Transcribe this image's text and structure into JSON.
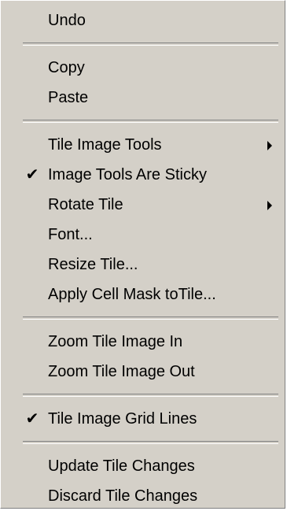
{
  "menu": {
    "groups": [
      {
        "items": [
          {
            "label": "Undo"
          }
        ]
      },
      {
        "items": [
          {
            "label": "Copy"
          },
          {
            "label": "Paste"
          }
        ]
      },
      {
        "items": [
          {
            "label": "Tile Image Tools",
            "submenu": true
          },
          {
            "label": "Image Tools Are Sticky",
            "checked": true
          },
          {
            "label": "Rotate Tile",
            "submenu": true
          },
          {
            "label": "Font..."
          },
          {
            "label": "Resize Tile..."
          },
          {
            "label": "Apply Cell Mask toTile..."
          }
        ]
      },
      {
        "items": [
          {
            "label": "Zoom Tile Image In"
          },
          {
            "label": "Zoom Tile Image Out"
          }
        ]
      },
      {
        "items": [
          {
            "label": "Tile Image Grid Lines",
            "checked": true
          }
        ]
      },
      {
        "items": [
          {
            "label": "Update Tile Changes"
          },
          {
            "label": "Discard Tile Changes"
          }
        ]
      }
    ],
    "check_glyph": "✔",
    "colors": {
      "background": "#d4d0c8",
      "text": "#000000",
      "shadow": "#808080",
      "highlight": "#ffffff"
    }
  }
}
